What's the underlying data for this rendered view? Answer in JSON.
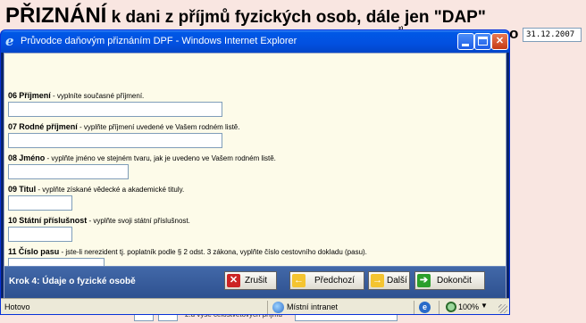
{
  "background_page": {
    "title_big": "PŘIZNÁNÍ",
    "title_rest": " k dani z příjmů fyzických osob, dále jen \"DAP\"",
    "marker": "²⁾",
    "o_letter": "o",
    "date": "31.12.2007",
    "bottom_text": "2.d výše celostvětových příjmů"
  },
  "window": {
    "title": "Průvodce daňovým přiznáním DPF - Windows Internet Explorer",
    "min_symbol": "",
    "close_symbol": "✕"
  },
  "fields": [
    {
      "number": "06",
      "name": "Příjmení",
      "hint": " - vyplníte současné příjmení.",
      "value": ""
    },
    {
      "number": "07",
      "name": "Rodné příjmení",
      "hint": " - vyplňte příjmení uvedené ve Vašem rodném listě.",
      "value": ""
    },
    {
      "number": "08",
      "name": "Jméno",
      "hint": " - vyplňte jméno ve stejném tvaru, jak je uvedeno ve Vašem rodném listě.",
      "value": ""
    },
    {
      "number": "09",
      "name": "Titul",
      "hint": " - vyplňte získané vědecké a akademické tituly.",
      "value": ""
    },
    {
      "number": "10",
      "name": "Státní příslušnost",
      "hint": " - vyplňte svoji státní příslušnost.",
      "value": ""
    },
    {
      "number": "11",
      "name": "Číslo pasu",
      "hint": " - jste-li nerezident tj. poplatník podle § 2 odst. 3 zákona, vyplňte číslo cestovního dokladu (pasu).",
      "value": ""
    }
  ],
  "footer": {
    "step_label": "Krok 4: Údaje o fyzické osobě",
    "cancel_label": "Zrušit",
    "prev_label": "Předchozí",
    "next_label": "Další",
    "finish_label": "Dokončit",
    "cancel_icon": "✕",
    "prev_icon": "←",
    "next_icon": "→",
    "finish_icon": "➔"
  },
  "status_bar": {
    "status": "Hotovo",
    "zone": "Místní intranet",
    "zoom": "100%",
    "zoom_caret": "▼",
    "ie_glyph": "e"
  },
  "colors": {
    "titlebar": "#0250e0",
    "footer": "#3a5fa0",
    "content_bg": "#fdfbe9"
  }
}
